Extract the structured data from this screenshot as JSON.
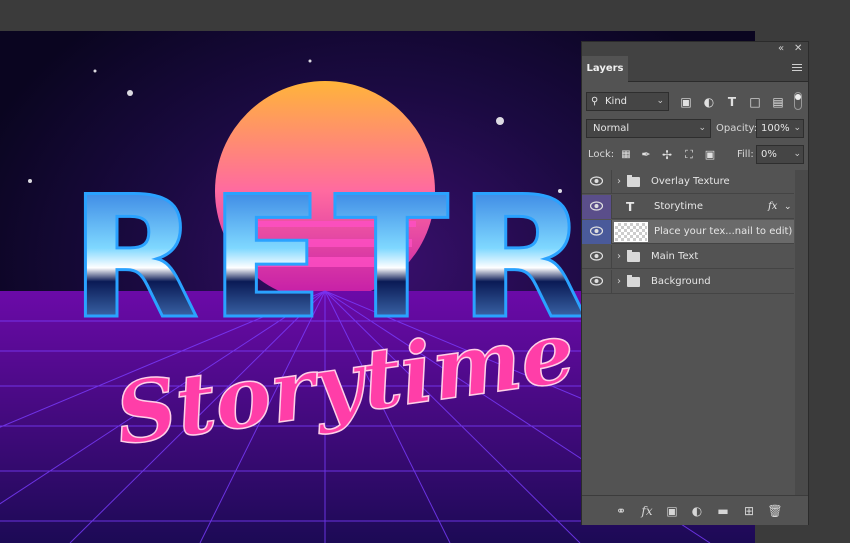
{
  "panel": {
    "tab_label": "Layers",
    "collapse_icon": "double-chevron-icon",
    "close_icon": "close-icon",
    "filter": {
      "kind_label": "Kind"
    },
    "blend_mode": "Normal",
    "opacity_label": "Opacity:",
    "opacity_value": "100%",
    "lock_label": "Lock:",
    "fill_label": "Fill:",
    "fill_value": "0%"
  },
  "layers": [
    {
      "name": "Overlay Texture",
      "type": "group"
    },
    {
      "name": "Storytime",
      "type": "text",
      "fx": "fx"
    },
    {
      "name": "Place your tex...nail to edit)",
      "type": "smart-object"
    },
    {
      "name": "Main Text",
      "type": "group"
    },
    {
      "name": "Background",
      "type": "group"
    }
  ],
  "artwork": {
    "title": "RETRO",
    "script": "Storytime"
  },
  "colors": {
    "panel_bg": "#535353",
    "selected_layer": "#5a4e8a",
    "selected_row": "#6a6a6a"
  }
}
